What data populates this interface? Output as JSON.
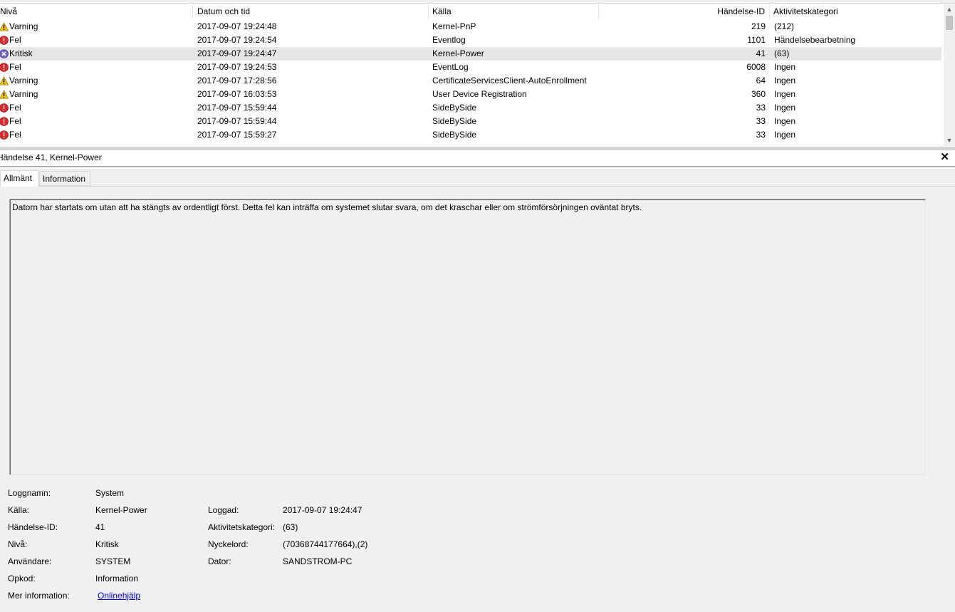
{
  "columns": {
    "level": "Nivå",
    "datetime": "Datum och tid",
    "source": "Källa",
    "event_id": "Händelse-ID",
    "category": "Aktivitetskategori"
  },
  "rows": [
    {
      "level": "Varning",
      "icon": "warning-icon",
      "datetime": "2017-09-07 19:24:48",
      "source": "Kernel-PnP",
      "event_id": "219",
      "category": "(212)"
    },
    {
      "level": "Fel",
      "icon": "error-icon",
      "datetime": "2017-09-07 19:24:54",
      "source": "Eventlog",
      "event_id": "1101",
      "category": "Händelsebearbetning"
    },
    {
      "level": "Kritisk",
      "icon": "critical-icon",
      "datetime": "2017-09-07 19:24:47",
      "source": "Kernel-Power",
      "event_id": "41",
      "category": "(63)"
    },
    {
      "level": "Fel",
      "icon": "error-icon",
      "datetime": "2017-09-07 19:24:53",
      "source": "EventLog",
      "event_id": "6008",
      "category": "Ingen"
    },
    {
      "level": "Varning",
      "icon": "warning-icon",
      "datetime": "2017-09-07 17:28:56",
      "source": "CertificateServicesClient-AutoEnrollment",
      "event_id": "64",
      "category": "Ingen"
    },
    {
      "level": "Varning",
      "icon": "warning-icon",
      "datetime": "2017-09-07 16:03:53",
      "source": "User Device Registration",
      "event_id": "360",
      "category": "Ingen"
    },
    {
      "level": "Fel",
      "icon": "error-icon",
      "datetime": "2017-09-07 15:59:44",
      "source": "SideBySide",
      "event_id": "33",
      "category": "Ingen"
    },
    {
      "level": "Fel",
      "icon": "error-icon",
      "datetime": "2017-09-07 15:59:44",
      "source": "SideBySide",
      "event_id": "33",
      "category": "Ingen"
    },
    {
      "level": "Fel",
      "icon": "error-icon",
      "datetime": "2017-09-07 15:59:27",
      "source": "SideBySide",
      "event_id": "33",
      "category": "Ingen"
    }
  ],
  "selected_row_index": 2,
  "details": {
    "title": "Händelse 41, Kernel-Power",
    "close": "✕",
    "tabs": [
      "Allmänt",
      "Information"
    ],
    "active_tab": "Allmänt",
    "description": "Datorn har startats om utan att ha stängts av ordentligt först. Detta fel kan inträffa om systemet slutar svara, om det kraschar eller om strömförsörjningen oväntat bryts.",
    "labels": {
      "log_name": "Loggnamn:",
      "source": "Källa:",
      "event_id": "Händelse-ID:",
      "level": "Nivå:",
      "user": "Användare:",
      "opcode": "Opkod:",
      "more_info": "Mer information:",
      "logged": "Loggad:",
      "task_category": "Aktivitetskategori:",
      "keywords": "Nyckelord:",
      "computer": "Dator:"
    },
    "values": {
      "log_name": "System",
      "source": "Kernel-Power",
      "event_id": "41",
      "level": "Kritisk",
      "user": "SYSTEM",
      "opcode": "Information",
      "more_info": "Onlinehjälp",
      "logged": "2017-09-07 19:24:47",
      "task_category": "(63)",
      "keywords": "(70368744177664),(2)",
      "computer": "SANDSTROM-PC"
    }
  },
  "colors": {
    "warning": "#f5c400",
    "error": "#e0272a",
    "critical": "#6f63c7",
    "selected_row": "#e6e6e6",
    "link": "#0000ee"
  }
}
